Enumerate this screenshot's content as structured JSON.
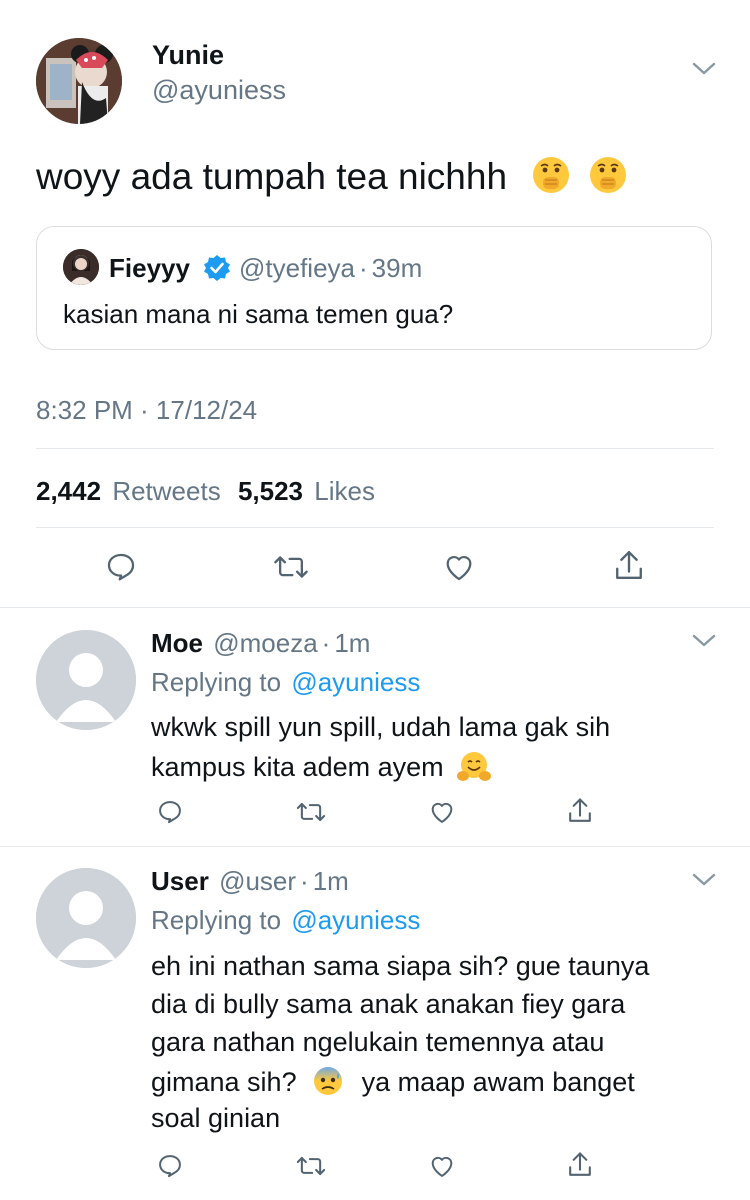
{
  "tweet": {
    "author_name": "Yunie",
    "author_handle": "@ayuniess",
    "text": "woyy ada tumpah tea nichhh",
    "emojis": [
      "shushing-face",
      "shushing-face"
    ],
    "quoted": {
      "author_name": "Fieyyy",
      "verified": true,
      "author_handle": "@tyefieya",
      "dot": "·",
      "time": "39m",
      "text": "kasian mana ni sama temen gua?"
    },
    "timestamp": "8:32 PM · 17/12/24",
    "retweets_count": "2,442",
    "retweets_label": "Retweets",
    "likes_count": "5,523",
    "likes_label": "Likes"
  },
  "replies": [
    {
      "name": "Moe",
      "handle": "@moeza",
      "dot": "·",
      "time": "1m",
      "replying_label": "Replying to",
      "replying_to": "@ayuniess",
      "line1": "wkwk spill yun spill, udah lama gak sih",
      "line2": "kampus kita adem ayem",
      "emoji": "hugging-face"
    },
    {
      "name": "User",
      "handle": "@user",
      "dot": "·",
      "time": "1m",
      "replying_label": "Replying to",
      "replying_to": "@ayuniess",
      "line1": "eh ini nathan sama siapa sih? gue taunya",
      "line2": "dia di bully sama anak anakan fiey gara",
      "line3": "gara nathan ngelukain temennya atau",
      "line4a": "gimana sih?",
      "line4b": "ya maap awam banget",
      "line5": "soal ginian",
      "emoji": "anxious-face-with-sweat"
    }
  ],
  "colors": {
    "accent": "#1d9bf0",
    "muted": "#657786",
    "divider": "#e6e9ec"
  }
}
